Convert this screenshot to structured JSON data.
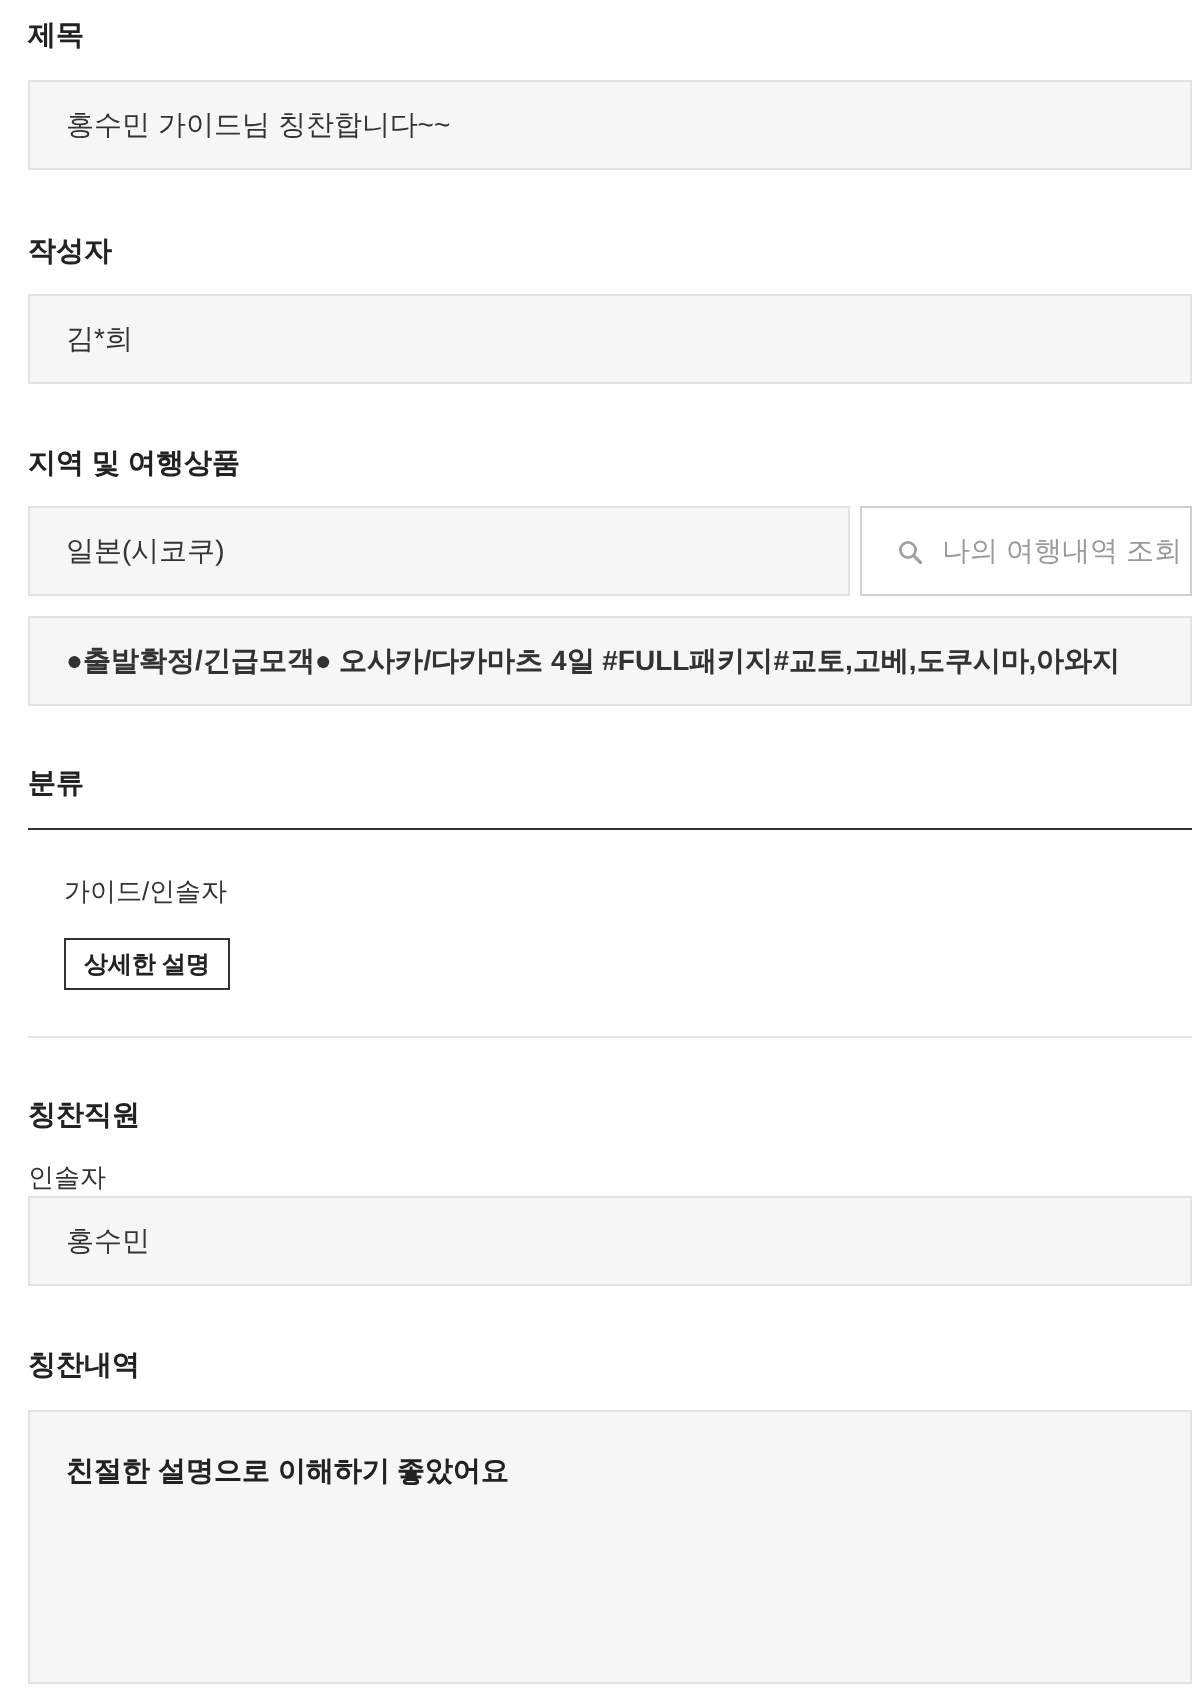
{
  "title": {
    "label": "제목",
    "value": "홍수민 가이드님 칭찬합니다~~"
  },
  "author": {
    "label": "작성자",
    "value": "김*희"
  },
  "region_product": {
    "label": "지역 및 여행상품",
    "region": "일본(시코쿠)",
    "search_button": "나의 여행내역 조회",
    "product": "●출발확정/긴급모객● 오사카/다카마츠 4일 #FULL패키지#교토,고베,도쿠시마,아와지"
  },
  "category": {
    "label": "분류",
    "value": "가이드/인솔자",
    "detail_button": "상세한 설명"
  },
  "praised_staff": {
    "label": "칭찬직원",
    "role": "인솔자",
    "name": "홍수민"
  },
  "praise_details": {
    "label": "칭찬내역",
    "text": "친절한 설명으로 이해하기 좋았어요"
  }
}
